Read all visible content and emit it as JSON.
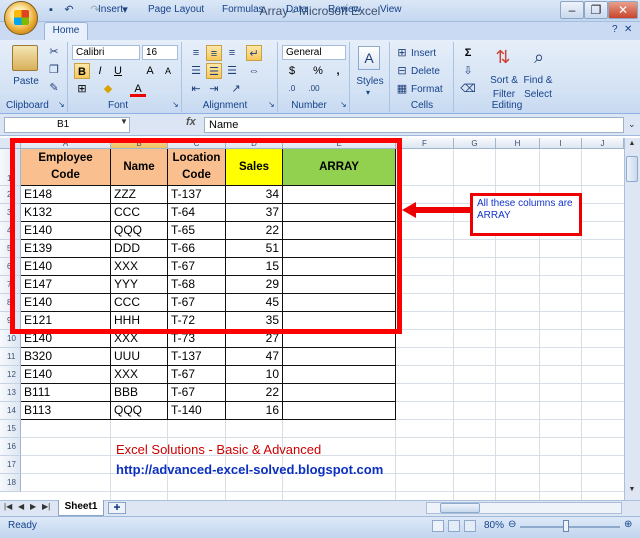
{
  "window": {
    "title": "Array - Microsoft Excel"
  },
  "tabs": [
    "Home",
    "Insert",
    "Page Layout",
    "Formulas",
    "Data",
    "Review",
    "View"
  ],
  "ribbon": {
    "clipboard": {
      "label": "Clipboard",
      "paste": "Paste"
    },
    "font": {
      "label": "Font",
      "name": "Calibri",
      "size": "16"
    },
    "alignment": {
      "label": "Alignment"
    },
    "number": {
      "label": "Number",
      "format": "General",
      "currency": "$",
      "percent": "%",
      "comma": ","
    },
    "styles": {
      "label": "Styles"
    },
    "cells": {
      "label": "Cells",
      "insert": "Insert",
      "delete": "Delete",
      "format": "Format"
    },
    "editing": {
      "label": "Editing",
      "sort": "Sort &",
      "filter": "Filter",
      "find": "Find &",
      "select": "Select"
    }
  },
  "formula_bar": {
    "name_box": "B1",
    "fx": "fx",
    "content": "Name"
  },
  "columns": [
    "A",
    "B",
    "C",
    "D",
    "E",
    "F",
    "G",
    "H",
    "I",
    "J"
  ],
  "rows": [
    "1",
    "2",
    "3",
    "4",
    "5",
    "6",
    "7",
    "8",
    "9",
    "10",
    "11",
    "12",
    "13",
    "14",
    "15",
    "16",
    "17",
    "18"
  ],
  "headers": {
    "a": "Employee Code",
    "b": "Name",
    "c": "Location Code",
    "d": "Sales",
    "e": "ARRAY"
  },
  "data": [
    [
      "E148",
      "ZZZ",
      "T-137",
      "34"
    ],
    [
      "K132",
      "CCC",
      "T-64",
      "37"
    ],
    [
      "E140",
      "QQQ",
      "T-65",
      "22"
    ],
    [
      "E139",
      "DDD",
      "T-66",
      "51"
    ],
    [
      "E140",
      "XXX",
      "T-67",
      "15"
    ],
    [
      "E147",
      "YYY",
      "T-68",
      "29"
    ],
    [
      "E140",
      "CCC",
      "T-67",
      "45"
    ],
    [
      "E121",
      "HHH",
      "T-72",
      "35"
    ],
    [
      "E140",
      "XXX",
      "T-73",
      "27"
    ],
    [
      "B320",
      "UUU",
      "T-137",
      "47"
    ],
    [
      "E140",
      "XXX",
      "T-67",
      "10"
    ],
    [
      "B111",
      "BBB",
      "T-67",
      "22"
    ],
    [
      "B113",
      "QQQ",
      "T-140",
      "16"
    ]
  ],
  "callout": "All these columns are ARRAY",
  "footer": {
    "title": "Excel Solutions - Basic & Advanced",
    "url": "http://advanced-excel-solved.blogspot.com"
  },
  "sheet_tab": "Sheet1",
  "status": {
    "ready": "Ready",
    "zoom": "80%"
  },
  "colors": {
    "header_orange": "#fabf8f",
    "header_yellow": "#ffff00",
    "header_green": "#92d050",
    "highlight_red": "#ff0000"
  }
}
